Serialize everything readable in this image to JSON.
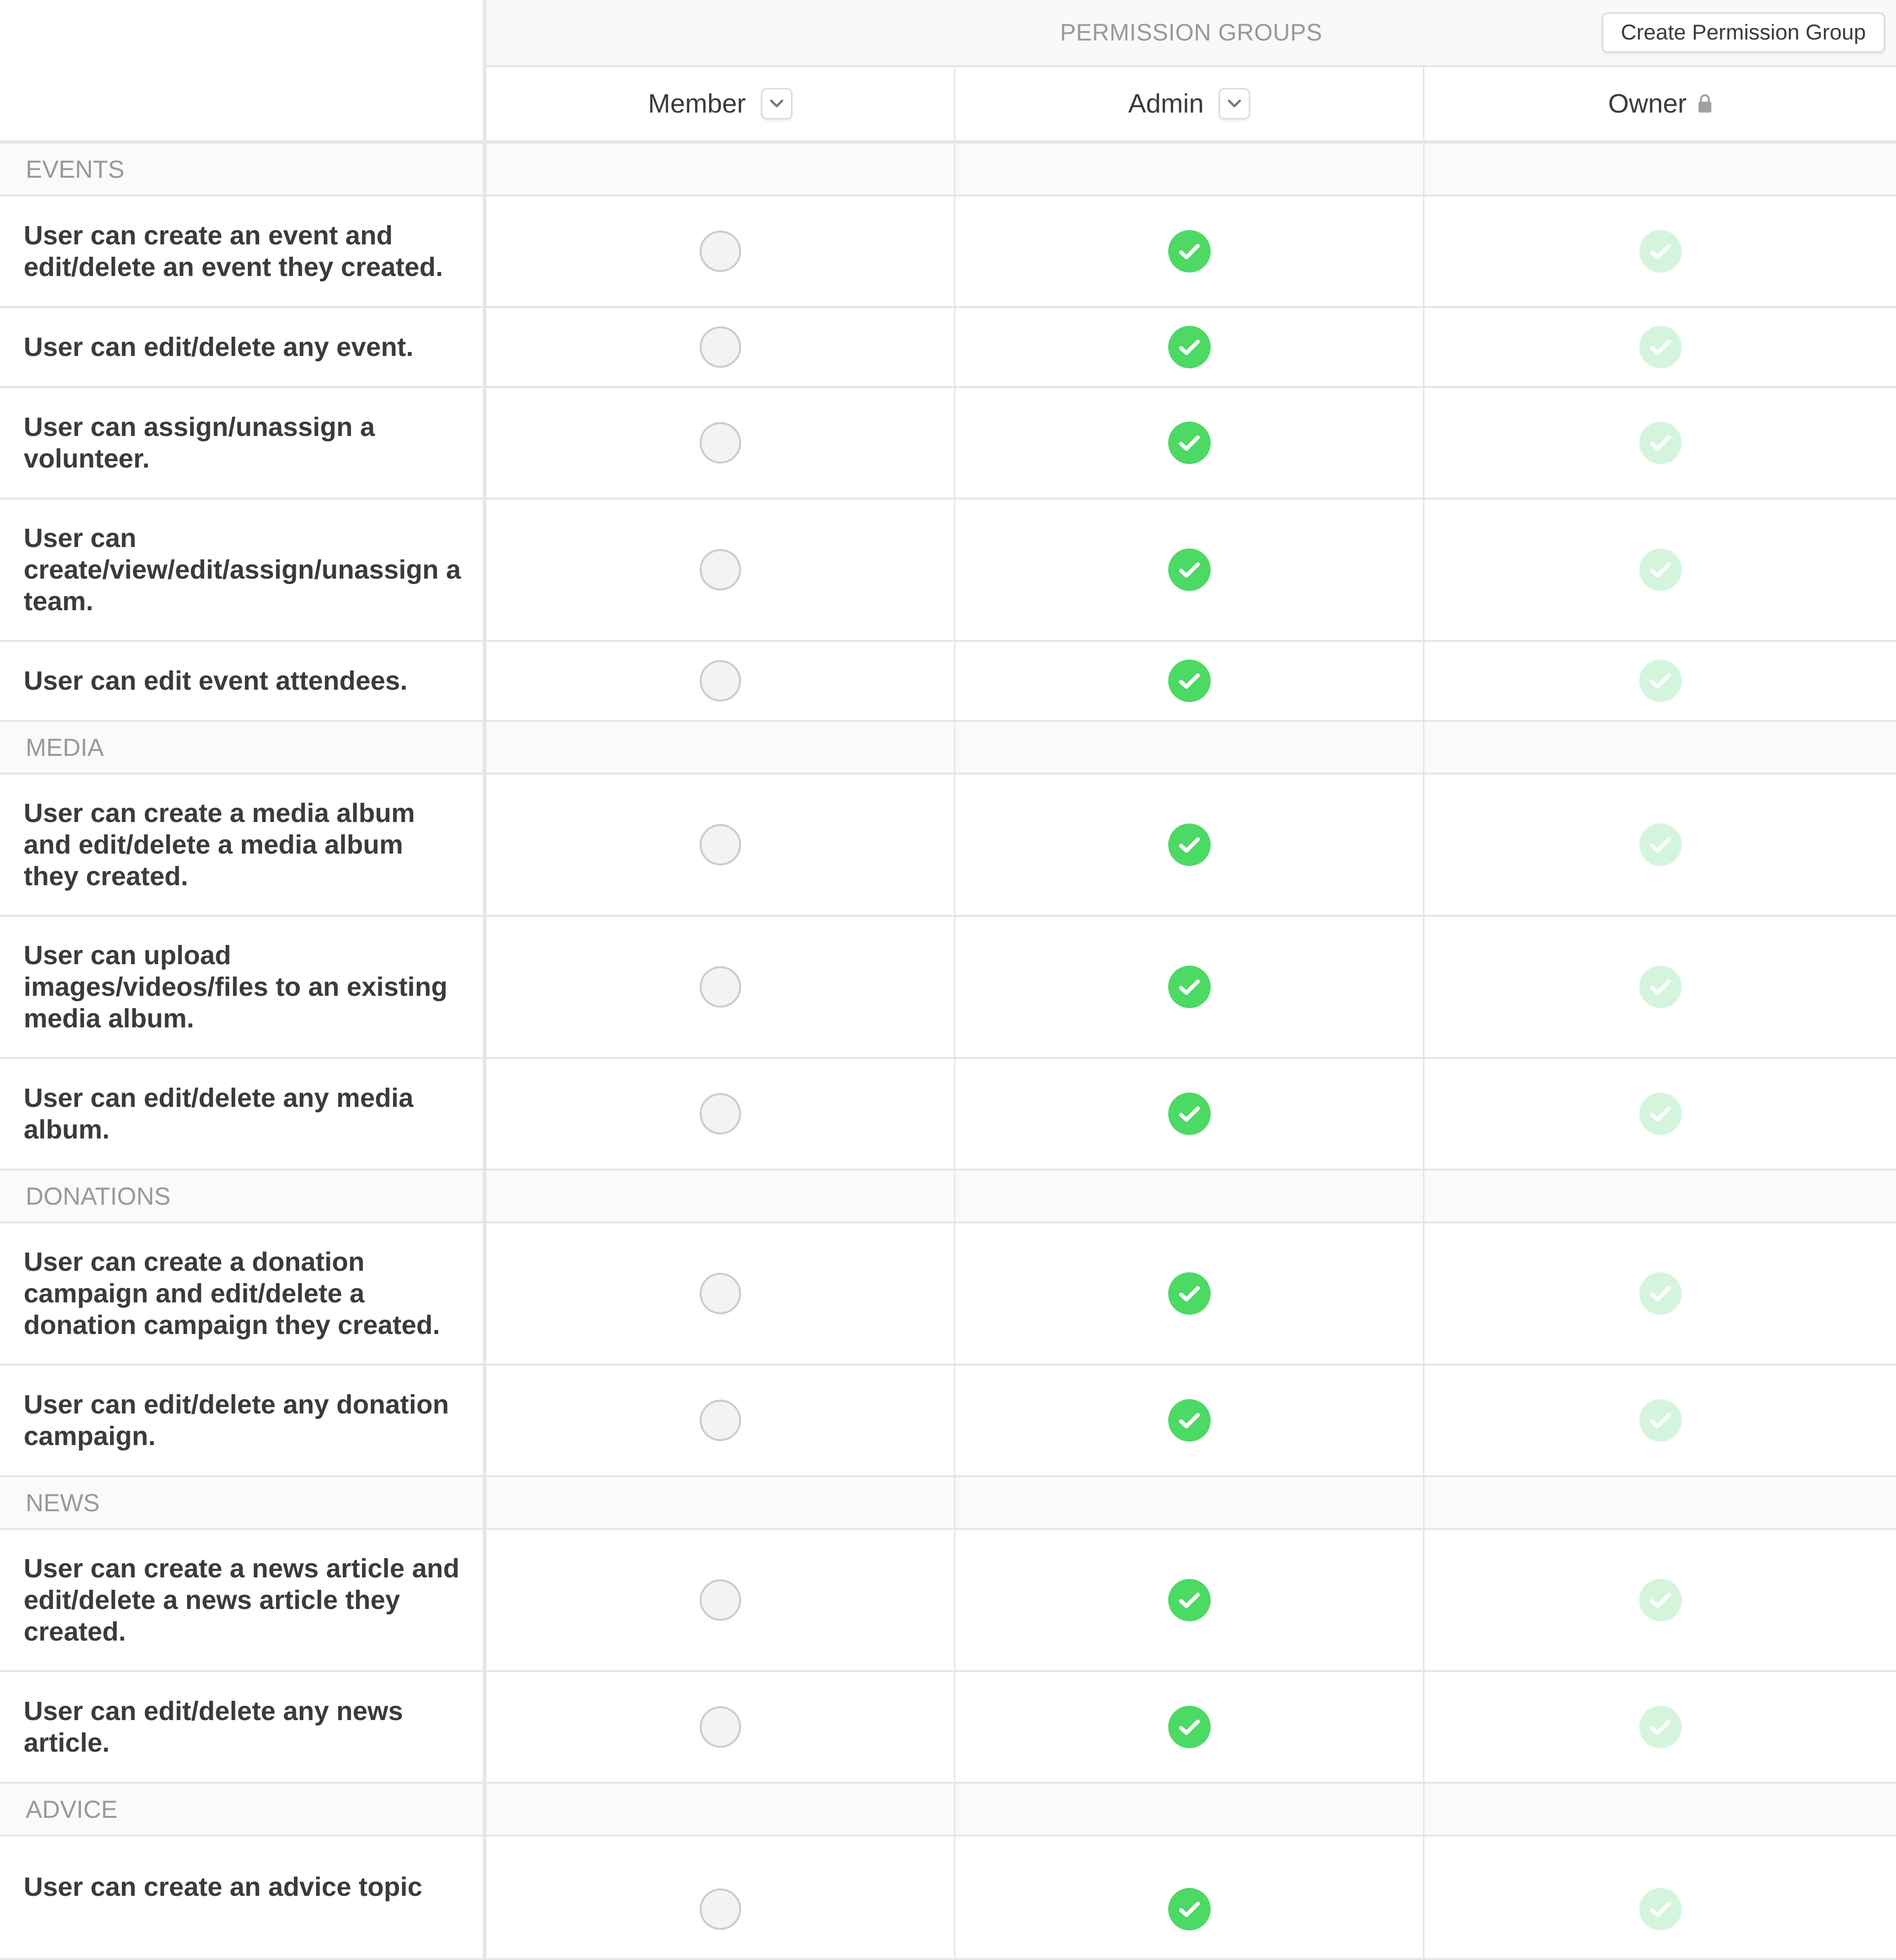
{
  "header": {
    "title": "PERMISSION GROUPS",
    "create_button_label": "Create Permission Group",
    "columns": [
      {
        "name": "Member",
        "control": "chevron-down-icon",
        "locked": false
      },
      {
        "name": "Admin",
        "control": "chevron-down-icon",
        "locked": false
      },
      {
        "name": "Owner",
        "control": "lock-icon",
        "locked": true
      }
    ]
  },
  "colors": {
    "checked": "#4cd964",
    "checked_locked": "#d4f5dc",
    "unchecked_fill": "#f3f3f3",
    "unchecked_border": "#cccccc",
    "section_text": "#999999",
    "body_text": "#3a3b3d"
  },
  "sections": [
    {
      "title": "EVENTS",
      "permissions": [
        {
          "label": "User can create an event and edit/delete an event they created.",
          "member": false,
          "admin": true,
          "owner": true
        },
        {
          "label": "User can edit/delete any event.",
          "member": false,
          "admin": true,
          "owner": true
        },
        {
          "label": "User can assign/unassign a volunteer.",
          "member": false,
          "admin": true,
          "owner": true
        },
        {
          "label": "User can create/view/edit/assign/unassign a team.",
          "member": false,
          "admin": true,
          "owner": true
        },
        {
          "label": "User can edit event attendees.",
          "member": false,
          "admin": true,
          "owner": true
        }
      ]
    },
    {
      "title": "MEDIA",
      "permissions": [
        {
          "label": "User can create a media album and edit/delete a media album they created.",
          "member": false,
          "admin": true,
          "owner": true
        },
        {
          "label": "User can upload images/videos/files to an existing media album.",
          "member": false,
          "admin": true,
          "owner": true
        },
        {
          "label": "User can edit/delete any media album.",
          "member": false,
          "admin": true,
          "owner": true
        }
      ]
    },
    {
      "title": "DONATIONS",
      "permissions": [
        {
          "label": "User can create a donation campaign and edit/delete a donation campaign they created.",
          "member": false,
          "admin": true,
          "owner": true
        },
        {
          "label": "User can edit/delete any donation campaign.",
          "member": false,
          "admin": true,
          "owner": true
        }
      ]
    },
    {
      "title": "NEWS",
      "permissions": [
        {
          "label": "User can create a news article and edit/delete a news article they created.",
          "member": false,
          "admin": true,
          "owner": true
        },
        {
          "label": "User can edit/delete any news article.",
          "member": false,
          "admin": true,
          "owner": true
        }
      ]
    },
    {
      "title": "ADVICE",
      "permissions": [
        {
          "label": "User can create an advice topic",
          "member": false,
          "admin": true,
          "owner": true
        }
      ]
    }
  ]
}
